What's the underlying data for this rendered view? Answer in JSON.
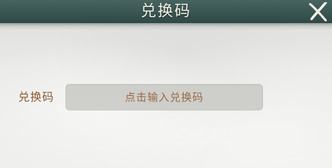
{
  "header": {
    "title": "兑换码"
  },
  "form": {
    "label": "兑换码",
    "placeholder": "点击输入兑换码"
  },
  "icons": {
    "close": "close-icon"
  },
  "colors": {
    "header_bg": "#3a5552",
    "title_text": "#f3f0e6",
    "label_text": "#8a5a35",
    "input_bg": "#c8c8c4"
  }
}
